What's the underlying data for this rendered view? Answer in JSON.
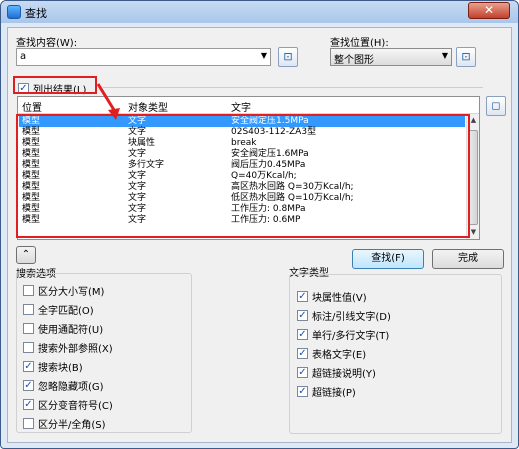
{
  "window": {
    "title": "查找",
    "close_label": "✕"
  },
  "search": {
    "find_what_label": "查找内容(W):",
    "find_what_value": "a",
    "find_where_label": "查找位置(H):",
    "find_where_value": "整个图形"
  },
  "list_results": {
    "label": "列出结果(L)",
    "checked": true
  },
  "results_table": {
    "columns": [
      "位置",
      "对象类型",
      "文字"
    ],
    "rows": [
      [
        "模型",
        "文字",
        "安全阀定压1.5MPa"
      ],
      [
        "模型",
        "文字",
        "02S403-112-ZA3型"
      ],
      [
        "模型",
        "块属性",
        "break"
      ],
      [
        "模型",
        "文字",
        "安全阀定压1.6MPa"
      ],
      [
        "模型",
        "多行文字",
        "阀后压力0.45MPa"
      ],
      [
        "模型",
        "文字",
        "Q=40万Kcal/h;"
      ],
      [
        "模型",
        "文字",
        "高区热水回路 Q=30万Kcal/h;"
      ],
      [
        "模型",
        "文字",
        "低区热水回路 Q=10万Kcal/h;"
      ],
      [
        "模型",
        "文字",
        "工作压力: 0.8MPa"
      ],
      [
        "模型",
        "文字",
        "工作压力: 0.6MP"
      ]
    ],
    "selected_row": 0
  },
  "buttons": {
    "find": "查找(F)",
    "done": "完成",
    "collapse": "⌃"
  },
  "search_options": {
    "title": "搜索选项",
    "items": [
      {
        "label": "区分大小写(M)",
        "checked": false
      },
      {
        "label": "全字匹配(O)",
        "checked": false
      },
      {
        "label": "使用通配符(U)",
        "checked": false
      },
      {
        "label": "搜索外部参照(X)",
        "checked": false
      },
      {
        "label": "搜索块(B)",
        "checked": true
      },
      {
        "label": "忽略隐藏项(G)",
        "checked": true
      },
      {
        "label": "区分变音符号(C)",
        "checked": true
      },
      {
        "label": "区分半/全角(S)",
        "checked": false
      }
    ]
  },
  "text_types": {
    "title": "文字类型",
    "items": [
      {
        "label": "块属性值(V)",
        "checked": true
      },
      {
        "label": "标注/引线文字(D)",
        "checked": true
      },
      {
        "label": "单行/多行文字(T)",
        "checked": true
      },
      {
        "label": "表格文字(E)",
        "checked": true
      },
      {
        "label": "超链接说明(Y)",
        "checked": true
      },
      {
        "label": "超链接(P)",
        "checked": true
      }
    ]
  },
  "colors": {
    "selection": "#3399ff",
    "highlight": "#e02020"
  }
}
